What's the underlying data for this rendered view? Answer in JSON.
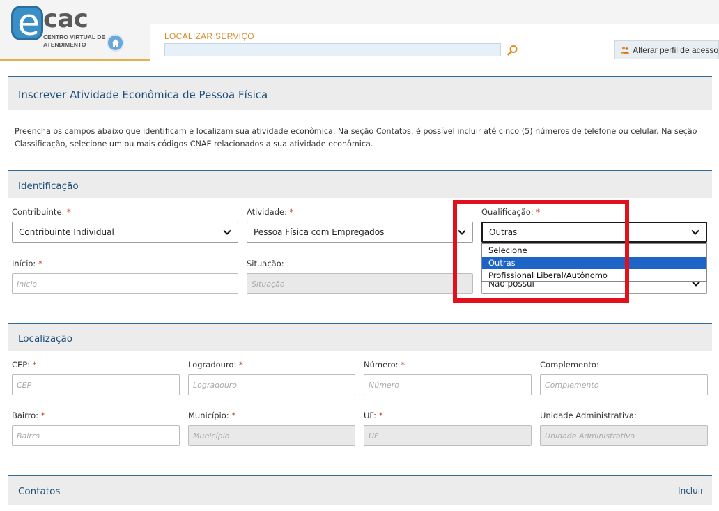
{
  "header": {
    "logo_e": "e",
    "logo_text": "cac",
    "logo_sub": "CENTRO VIRTUAL DE ATENDIMENTO",
    "search_label": "LOCALIZAR SERVIÇO",
    "search_value": "",
    "profile_label": "Alterar perfil de acesso",
    "colors": {
      "accent": "#e8b04a",
      "brand": "#3a8fc7"
    }
  },
  "page": {
    "title": "Inscrever Atividade Econômica de Pessoa Física",
    "intro": "Preencha os campos abaixo que identificam e localizam sua atividade econômica. Na seção Contatos, é possível incluir até cinco (5) números de telefone ou celular. Na seção Classificação, selecione um ou mais códigos CNAE relacionados a sua atividade econômica."
  },
  "identificacao": {
    "heading": "Identificação",
    "contribuinte": {
      "label": "Contribuinte:",
      "value": "Contribuinte Individual"
    },
    "atividade": {
      "label": "Atividade:",
      "value": "Pessoa Física com Empregados"
    },
    "qualificacao": {
      "label": "Qualificação:",
      "value": "Outras",
      "options": [
        "Selecione",
        "Outras",
        "Profissional Liberal/Autônomo"
      ],
      "highlighted": "Outras"
    },
    "inicio": {
      "label": "Início:",
      "placeholder": "Início"
    },
    "situacao": {
      "label": "Situação:",
      "placeholder": "Situação"
    },
    "hidden_select_value": "Não possui"
  },
  "localizacao": {
    "heading": "Localização",
    "cep": {
      "label": "CEP:",
      "placeholder": "CEP"
    },
    "logradouro": {
      "label": "Logradouro:",
      "placeholder": "Logradouro"
    },
    "numero": {
      "label": "Número:",
      "placeholder": "Número"
    },
    "complemento": {
      "label": "Complemento:",
      "placeholder": "Complemento"
    },
    "bairro": {
      "label": "Bairro:",
      "placeholder": "Bairro"
    },
    "municipio": {
      "label": "Município:",
      "placeholder": "Município"
    },
    "uf": {
      "label": "UF:",
      "placeholder": "UF"
    },
    "unidade": {
      "label": "Unidade Administrativa:",
      "placeholder": "Unidade Administrativa"
    }
  },
  "contatos": {
    "heading": "Contatos",
    "incluir": "Incluir"
  },
  "required_mark": "*"
}
